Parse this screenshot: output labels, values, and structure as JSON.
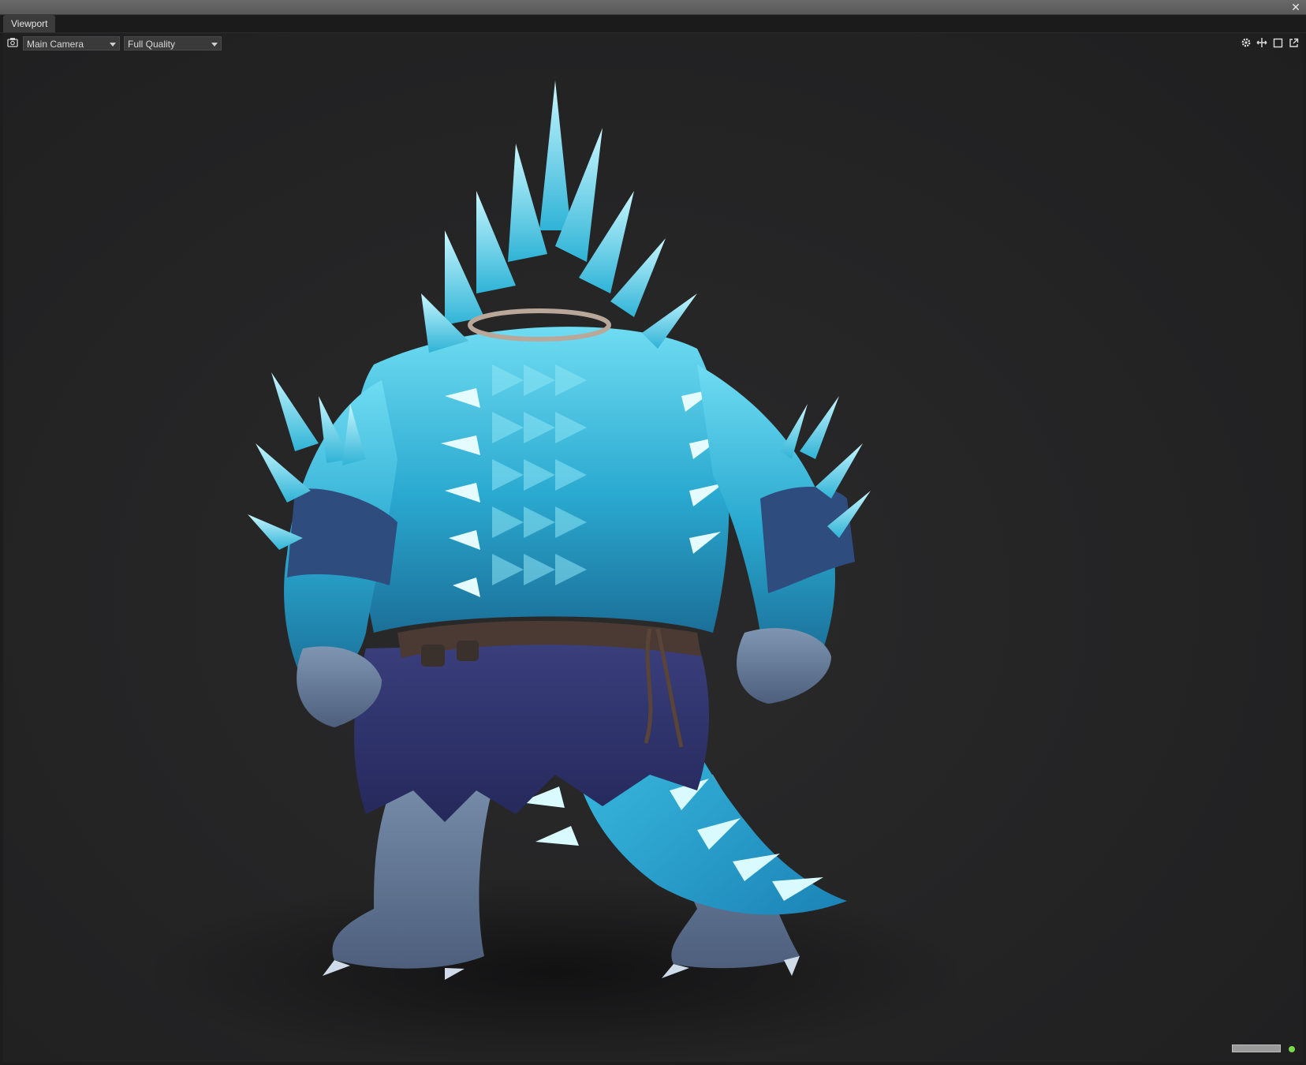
{
  "window": {
    "tab_label": "Viewport",
    "close_glyph": "✕"
  },
  "toolbar": {
    "camera_icon": "camera-icon",
    "camera_select": "Main Camera",
    "quality_select": "Full Quality",
    "right_icons": [
      "gear-icon",
      "move-icon",
      "maximize-icon",
      "popout-icon"
    ]
  },
  "status": {
    "indicator_color": "#7ad94b"
  },
  "colors": {
    "titlebar": "#5e5e5e",
    "viewport_bg": "#252526",
    "ice_light": "#7fe3f5",
    "ice_mid": "#2fb7d8",
    "ice_dark": "#1a6f9a",
    "cloth": "#2c2e63",
    "skin": "#5b6f8a"
  }
}
